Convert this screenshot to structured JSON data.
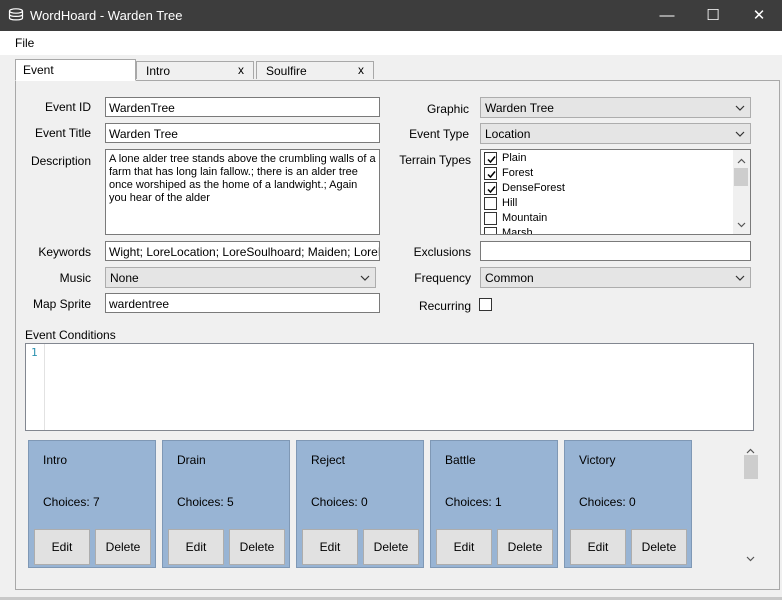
{
  "window": {
    "title": "WordHoard - Warden Tree",
    "minimize_glyph": "—",
    "maximize_glyph": "☐",
    "close_glyph": "✕"
  },
  "menu": {
    "file": "File"
  },
  "tabs": [
    {
      "label": "Event",
      "closable": false
    },
    {
      "label": "Intro",
      "close": "x"
    },
    {
      "label": "Soulfire",
      "close": "x"
    }
  ],
  "form": {
    "event_id_label": "Event ID",
    "event_id_value": "WardenTree",
    "event_title_label": "Event Title",
    "event_title_value": "Warden Tree",
    "description_label": "Description",
    "description_value": "A lone alder tree stands above the crumbling walls of a farm that has long lain fallow.; there is an alder tree once worshiped as the home of a landwight.; Again you hear of the alder",
    "keywords_label": "Keywords",
    "keywords_value": "Wight; LoreLocation; LoreSoulhoard; Maiden; LoreMaide",
    "music_label": "Music",
    "music_value": "None",
    "map_sprite_label": "Map Sprite",
    "map_sprite_value": "wardentree",
    "graphic_label": "Graphic",
    "graphic_value": "Warden Tree",
    "event_type_label": "Event Type",
    "event_type_value": "Location",
    "terrain_types_label": "Terrain Types",
    "terrain_types": [
      {
        "name": "Plain",
        "checked": true
      },
      {
        "name": "Forest",
        "checked": true
      },
      {
        "name": "DenseForest",
        "checked": true
      },
      {
        "name": "Hill",
        "checked": false
      },
      {
        "name": "Mountain",
        "checked": false
      },
      {
        "name": "Marsh",
        "checked": false
      }
    ],
    "exclusions_label": "Exclusions",
    "exclusions_value": "",
    "frequency_label": "Frequency",
    "frequency_value": "Common",
    "recurring_label": "Recurring",
    "recurring_checked": false
  },
  "conditions": {
    "label": "Event Conditions",
    "line_number": "1"
  },
  "cards": [
    {
      "name": "Intro",
      "choices": "Choices: 7",
      "edit": "Edit",
      "delete": "Delete"
    },
    {
      "name": "Drain",
      "choices": "Choices: 5",
      "edit": "Edit",
      "delete": "Delete"
    },
    {
      "name": "Reject",
      "choices": "Choices: 0",
      "edit": "Edit",
      "delete": "Delete"
    },
    {
      "name": "Battle",
      "choices": "Choices: 1",
      "edit": "Edit",
      "delete": "Delete"
    },
    {
      "name": "Victory",
      "choices": "Choices: 0",
      "edit": "Edit",
      "delete": "Delete"
    }
  ]
}
